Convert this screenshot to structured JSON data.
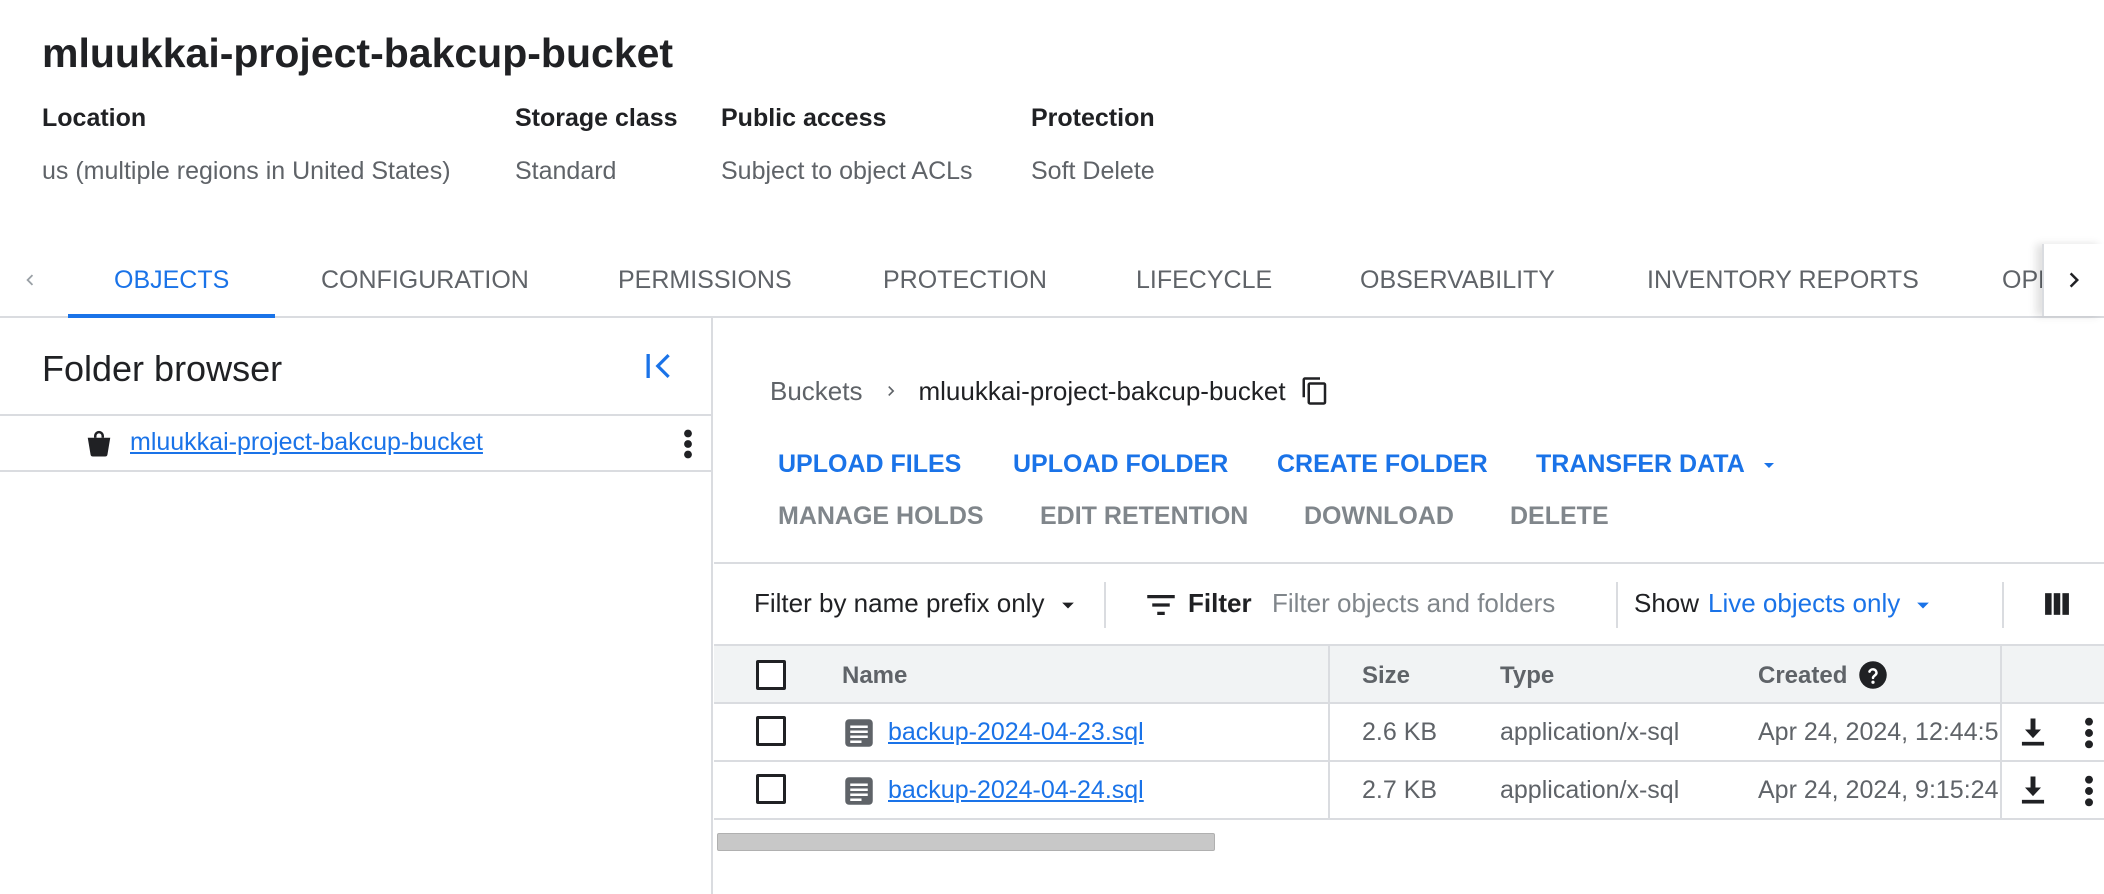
{
  "bucket_title": "mluukkai-project-bakcup-bucket",
  "meta": {
    "location": {
      "label": "Location",
      "value": "us (multiple regions in United States)"
    },
    "storage_class": {
      "label": "Storage class",
      "value": "Standard"
    },
    "public_access": {
      "label": "Public access",
      "value": "Subject to object ACLs"
    },
    "protection": {
      "label": "Protection",
      "value": "Soft Delete"
    }
  },
  "tabs": [
    {
      "label": "OBJECTS",
      "active": true
    },
    {
      "label": "CONFIGURATION"
    },
    {
      "label": "PERMISSIONS"
    },
    {
      "label": "PROTECTION"
    },
    {
      "label": "LIFECYCLE"
    },
    {
      "label": "OBSERVABILITY"
    },
    {
      "label": "INVENTORY REPORTS"
    },
    {
      "label": "OPE"
    }
  ],
  "folder_browser": {
    "title": "Folder browser",
    "bucket_name": "mluukkai-project-bakcup-bucket"
  },
  "breadcrumb": {
    "root": "Buckets",
    "current": "mluukkai-project-bakcup-bucket"
  },
  "actions": {
    "upload_files": "UPLOAD FILES",
    "upload_folder": "UPLOAD FOLDER",
    "create_folder": "CREATE FOLDER",
    "transfer_data": "TRANSFER DATA",
    "manage_holds": "MANAGE HOLDS",
    "edit_retention": "EDIT RETENTION",
    "download": "DOWNLOAD",
    "delete": "DELETE"
  },
  "filter": {
    "prefix_mode": "Filter by name prefix only",
    "label": "Filter",
    "placeholder": "Filter objects and folders",
    "show_label": "Show",
    "show_value": "Live objects only"
  },
  "table": {
    "headers": {
      "name": "Name",
      "size": "Size",
      "type": "Type",
      "created": "Created"
    },
    "rows": [
      {
        "name": "backup-2024-04-23.sql",
        "size": "2.6 KB",
        "type": "application/x-sql",
        "created": "Apr 24, 2024, 12:44:5"
      },
      {
        "name": "backup-2024-04-24.sql",
        "size": "2.7 KB",
        "type": "application/x-sql",
        "created": "Apr 24, 2024, 9:15:24"
      }
    ]
  },
  "colors": {
    "accent": "#1a73e8",
    "text": "#202124",
    "muted": "#5f6368",
    "border": "#dadce0"
  }
}
